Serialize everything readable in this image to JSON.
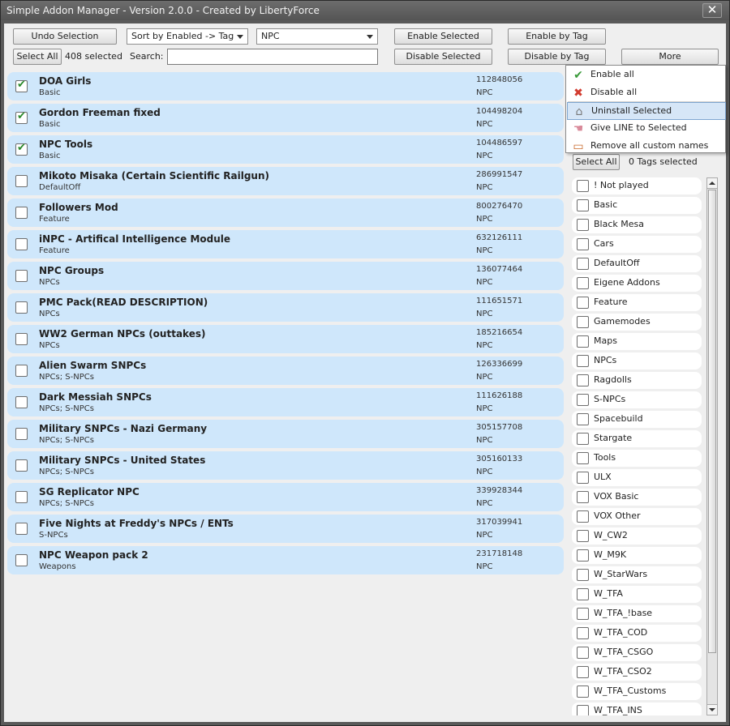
{
  "window": {
    "title": "Simple Addon Manager - Version 2.0.0 - Created by LibertyForce",
    "close_glyph": "✕"
  },
  "toolbar": {
    "undo_label": "Undo Selection",
    "sort_value": "Sort by Enabled -> Tag",
    "filter_value": "NPC",
    "enable_selected_label": "Enable Selected",
    "enable_by_tag_label": "Enable by Tag",
    "select_all_label": "Select All",
    "selected_count": "408 selected",
    "search_label": "Search:",
    "search_value": "",
    "disable_selected_label": "Disable Selected",
    "disable_by_tag_label": "Disable by Tag",
    "more_label": "More"
  },
  "menu": {
    "items": [
      {
        "label": "Enable all",
        "icon": "check-icon"
      },
      {
        "label": "Disable all",
        "icon": "x-icon"
      },
      {
        "label": "Uninstall Selected",
        "icon": "uninstall-icon",
        "highlighted": true
      },
      {
        "label": "Give LINE to Selected",
        "icon": "hand-icon"
      },
      {
        "label": "Remove all custom names",
        "icon": "eraser-icon"
      }
    ]
  },
  "tags_panel": {
    "select_all_label": "Select All",
    "count_label": "0 Tags selected",
    "tags": [
      "! Not played",
      "Basic",
      "Black Mesa",
      "Cars",
      "DefaultOff",
      "Eigene Addons",
      "Feature",
      "Gamemodes",
      "Maps",
      "NPCs",
      "Ragdolls",
      "S-NPCs",
      "Spacebuild",
      "Stargate",
      "Tools",
      "ULX",
      "VOX Basic",
      "VOX Other",
      "W_CW2",
      "W_M9K",
      "W_StarWars",
      "W_TFA",
      "W_TFA_!base",
      "W_TFA_COD",
      "W_TFA_CSGO",
      "W_TFA_CSO2",
      "W_TFA_Customs",
      "W_TFA_INS"
    ]
  },
  "addons": [
    {
      "name": "DOA Girls",
      "tags": "Basic",
      "id": "112848056",
      "category": "NPC",
      "checked": true
    },
    {
      "name": "Gordon Freeman fixed",
      "tags": "Basic",
      "id": "104498204",
      "category": "NPC",
      "checked": true
    },
    {
      "name": "NPC Tools",
      "tags": "Basic",
      "id": "104486597",
      "category": "NPC",
      "checked": true
    },
    {
      "name": "Mikoto Misaka (Certain Scientific Railgun)",
      "tags": "DefaultOff",
      "id": "286991547",
      "category": "NPC",
      "checked": false
    },
    {
      "name": "Followers Mod",
      "tags": "Feature",
      "id": "800276470",
      "category": "NPC",
      "checked": false
    },
    {
      "name": "iNPC - Artifical Intelligence Module",
      "tags": "Feature",
      "id": "632126111",
      "category": "NPC",
      "checked": false
    },
    {
      "name": "NPC Groups",
      "tags": "NPCs",
      "id": "136077464",
      "category": "NPC",
      "checked": false
    },
    {
      "name": "PMC Pack(READ DESCRIPTION)",
      "tags": "NPCs",
      "id": "111651571",
      "category": "NPC",
      "checked": false
    },
    {
      "name": "WW2 German NPCs (outtakes)",
      "tags": "NPCs",
      "id": "185216654",
      "category": "NPC",
      "checked": false
    },
    {
      "name": "Alien Swarm SNPCs",
      "tags": "NPCs; S-NPCs",
      "id": "126336699",
      "category": "NPC",
      "checked": false
    },
    {
      "name": "Dark Messiah SNPCs",
      "tags": "NPCs; S-NPCs",
      "id": "111626188",
      "category": "NPC",
      "checked": false
    },
    {
      "name": "Military SNPCs - Nazi Germany",
      "tags": "NPCs; S-NPCs",
      "id": "305157708",
      "category": "NPC",
      "checked": false
    },
    {
      "name": "Military SNPCs - United States",
      "tags": "NPCs; S-NPCs",
      "id": "305160133",
      "category": "NPC",
      "checked": false
    },
    {
      "name": "SG Replicator NPC",
      "tags": "NPCs; S-NPCs",
      "id": "339928344",
      "category": "NPC",
      "checked": false
    },
    {
      "name": "Five Nights at Freddy's NPCs / ENTs",
      "tags": "S-NPCs",
      "id": "317039941",
      "category": "NPC",
      "checked": false
    },
    {
      "name": "NPC Weapon pack 2",
      "tags": "Weapons",
      "id": "231718148",
      "category": "NPC",
      "checked": false
    }
  ]
}
